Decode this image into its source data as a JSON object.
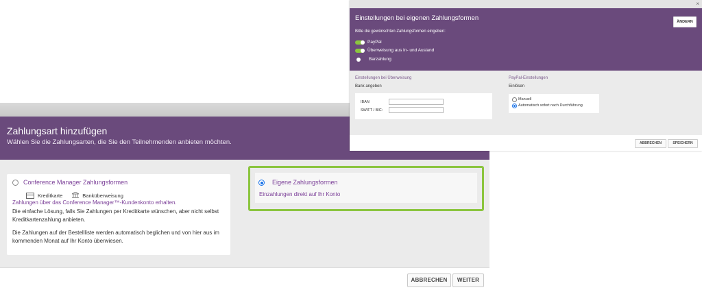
{
  "main_dialog": {
    "title": "Zahlungsart hinzufügen",
    "subtitle": "Wählen Sie die Zahlungsarten, die Sie den Teilnehmenden anbieten möchten.",
    "option_cm": {
      "title": "Conference Manager Zahlungsformen",
      "method_card": "Kreditkarte",
      "method_bank": "Banküberweisung",
      "link": "Zahlungen über das Conference Manager™-Kundenkonto erhalten.",
      "desc1": "Die einfache Lösung, falls Sie Zahlungen per Kreditkarte wünschen, aber nicht selbst Kreditkartenzahlung anbieten.",
      "desc2": "Die Zahlungen auf der Bestellliste werden automatisch beglichen und von hier aus im kommenden Monat auf Ihr Konto überwiesen."
    },
    "option_own": {
      "title": "Eigene Zahlungsformen",
      "desc": "Einzahlungen direkt auf Ihr Konto"
    },
    "cancel_label": "ABBRECHEN",
    "next_label": "WEITER"
  },
  "settings_dialog": {
    "close_icon": "×",
    "title": "Einstellungen bei eigenen Zahlungsformen",
    "change_label": "ÄNDERN",
    "prompt": "Bitte die gewünschten Zahlungsformen eingeben:",
    "methods": [
      {
        "label": "PayPal",
        "enabled": true
      },
      {
        "label": "Überweisung aus In- und Ausland",
        "enabled": true
      },
      {
        "label": "Barzahlung",
        "enabled": false
      }
    ],
    "transfer": {
      "heading": "Einstellungen bei Überweisung",
      "sub": "Bank angeben",
      "iban_label": "IBAN",
      "swift_label": "SWIFT / BIC:"
    },
    "paypal": {
      "heading": "PayPal-Einstellungen",
      "sub": "Einlösen",
      "opt_manual": "Manuell",
      "opt_auto": "Automatisch sofort nach Durchführung"
    },
    "cancel_label": "ABBRECHEN",
    "save_label": "SPEICHERN"
  },
  "colors": {
    "header_purple": "#6a4a7c",
    "link_purple": "#7b3f98",
    "highlight_green": "#8bc53f",
    "radio_blue": "#1a73e8"
  }
}
